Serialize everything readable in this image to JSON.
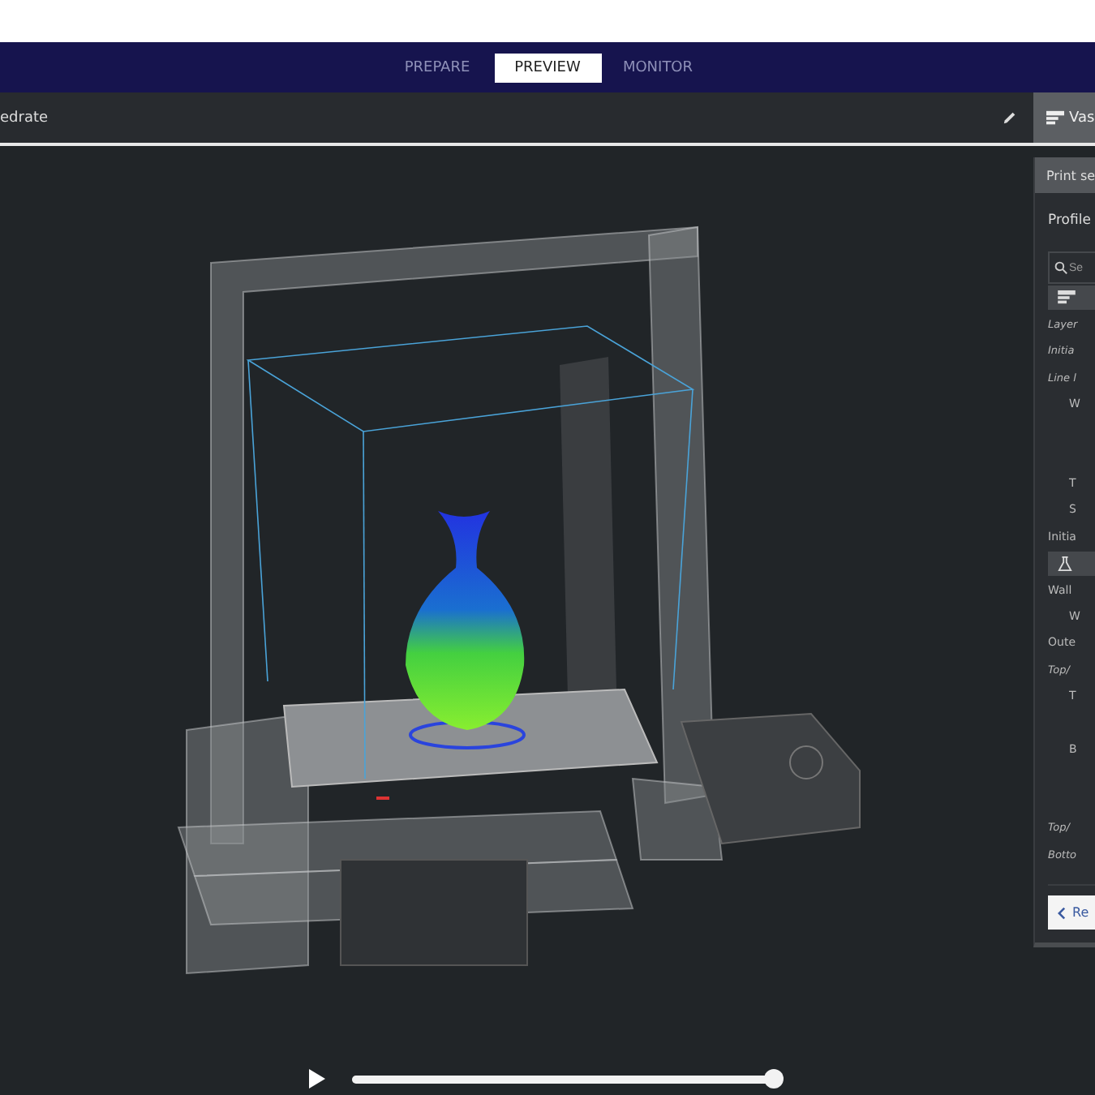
{
  "tabs": [
    {
      "label": "PREPARE",
      "selected": false
    },
    {
      "label": "PREVIEW",
      "selected": true
    },
    {
      "label": "MONITOR",
      "selected": false
    }
  ],
  "toolbar": {
    "view_type": "edrate",
    "profile": "Vas"
  },
  "print_settings": {
    "title": "Print se",
    "profile_label": "Profile",
    "search": {
      "placeholder": "Se"
    },
    "items": [
      {
        "kind": "category"
      },
      {
        "kind": "setting",
        "label": "Layer",
        "italic": true
      },
      {
        "kind": "setting",
        "label": "Initia",
        "italic": true
      },
      {
        "kind": "setting",
        "label": "Line l",
        "italic": true,
        "children": [
          {
            "kind": "setting",
            "label": "W",
            "italic": false
          },
          {
            "kind": "spacer"
          },
          {
            "kind": "spacer"
          },
          {
            "kind": "setting",
            "label": "T",
            "italic": false
          },
          {
            "kind": "setting",
            "label": "S",
            "italic": false
          }
        ]
      },
      {
        "kind": "setting",
        "label": "Initia",
        "italic": false
      },
      {
        "kind": "category"
      },
      {
        "kind": "setting",
        "label": "Wall",
        "italic": false,
        "children": [
          {
            "kind": "setting",
            "label": "W",
            "italic": false
          }
        ]
      },
      {
        "kind": "setting",
        "label": "Oute",
        "italic": false
      },
      {
        "kind": "setting",
        "label": "Top/",
        "italic": true,
        "children": [
          {
            "kind": "setting",
            "label": "T",
            "italic": false
          },
          {
            "kind": "spacer"
          },
          {
            "kind": "setting",
            "label": "B",
            "italic": false
          },
          {
            "kind": "spacer"
          },
          {
            "kind": "spacer"
          }
        ]
      },
      {
        "kind": "setting",
        "label": "Top/",
        "italic": true
      },
      {
        "kind": "setting",
        "label": "Botto",
        "italic": true
      }
    ],
    "button": "Re"
  },
  "playback": {
    "level": 1.0
  }
}
